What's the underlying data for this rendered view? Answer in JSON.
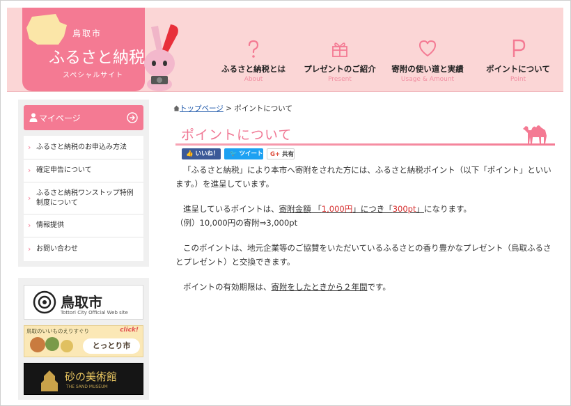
{
  "header": {
    "badge_text": "TOTTORI CITY",
    "city": "鳥取市",
    "title": "ふるさと納税",
    "subtitle": "スペシャルサイト",
    "nav": [
      {
        "label": "ふるさと納税とは",
        "en": "About",
        "icon": "question-icon"
      },
      {
        "label": "プレゼントのご紹介",
        "en": "Present",
        "icon": "gift-icon"
      },
      {
        "label": "寄附の使い道と実績",
        "en": "Usage & Amount",
        "icon": "heart-icon"
      },
      {
        "label": "ポイントについて",
        "en": "Point",
        "icon": "point-p-icon"
      }
    ],
    "accent_color": "#f47a93",
    "bg_color": "#fbd6d6"
  },
  "sidebar": {
    "mypage_label": "マイページ",
    "menu": [
      "ふるさと納税のお申込み方法",
      "確定申告について",
      "ふるさと納税ワンストップ特例制度について",
      "情報提供",
      "お問い合わせ"
    ],
    "banners": {
      "city_name": "鳥取市",
      "city_en": "Tottori City Official Web site",
      "shop_caption": "鳥取のいいものえりすぐり",
      "shop_click": "click!",
      "shop_name": "とっとり市",
      "museum_name": "砂の美術館",
      "museum_en": "THE SAND MUSEUM"
    }
  },
  "breadcrumb": {
    "home": "トップページ",
    "separator": ">",
    "current": "ポイントについて"
  },
  "page_title": "ポイントについて",
  "share": {
    "facebook": "いいね！",
    "twitter": "ツイート",
    "google": "共有"
  },
  "content": {
    "p1": "「ふるさと納税」により本市へ寄附をされた方には、ふるさと納税ポイント（以下「ポイント」といいます。）を進呈しています。",
    "p2_prefix": "進呈しているポイントは、",
    "p2_link1": "寄附金額 「",
    "p2_amount": "1,000円",
    "p2_link2": "」につき「",
    "p2_points": "300pt",
    "p2_link3": "」",
    "p2_suffix": "になります。",
    "p3": "（例）10,000円の寄附⇒3,000pt",
    "p4": "このポイントは、地元企業等のご協賛をいただいているふるさとの香り豊かなプレゼント（鳥取ふるさとプレゼント）と交換できます。",
    "p5_prefix": "ポイントの有効期限は、",
    "p5_link": "寄附をしたときから２年間",
    "p5_suffix": "です。"
  }
}
